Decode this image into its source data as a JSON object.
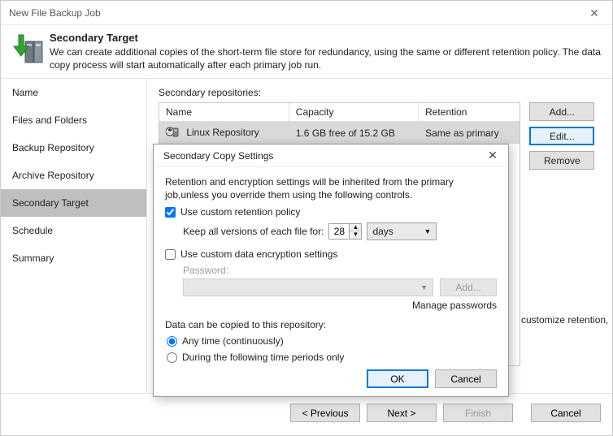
{
  "window": {
    "title": "New File Backup Job"
  },
  "header": {
    "title": "Secondary Target",
    "desc": "We can create additional copies of the short-term file store for redundancy, using the same or different retention policy. The data copy process will start automatically after each primary job run."
  },
  "sidebar": {
    "items": [
      {
        "label": "Name"
      },
      {
        "label": "Files and Folders"
      },
      {
        "label": "Backup Repository"
      },
      {
        "label": "Archive Repository"
      },
      {
        "label": "Secondary Target"
      },
      {
        "label": "Schedule"
      },
      {
        "label": "Summary"
      }
    ],
    "selected_index": 4
  },
  "main": {
    "list_label": "Secondary repositories:",
    "columns": {
      "c0": "Name",
      "c1": "Capacity",
      "c2": "Retention"
    },
    "rows": [
      {
        "name": "Linux Repository",
        "capacity": "1.6 GB free of 15.2 GB",
        "retention": "Same as primary"
      }
    ],
    "buttons": {
      "add": "Add...",
      "edit": "Edit...",
      "remove": "Remove"
    },
    "cust_note": "customize retention,"
  },
  "popup": {
    "title": "Secondary Copy Settings",
    "desc": "Retention and encryption settings will be inherited from the primary job,unless you override them using the following controls.",
    "use_custom_retention": "Use custom retention policy",
    "keep_label": "Keep all versions of each file for:",
    "keep_value": "28",
    "keep_unit": "days",
    "use_custom_encryption": "Use custom data encryption settings",
    "password_label": "Password:",
    "add_btn": "Add...",
    "manage": "Manage passwords",
    "copy_label": "Data can be copied to this repository:",
    "radio1": "Any time (continuously)",
    "radio2": "During the following time periods only",
    "ok": "OK",
    "cancel": "Cancel"
  },
  "footer": {
    "previous": "< Previous",
    "next": "Next >",
    "finish": "Finish",
    "cancel": "Cancel"
  }
}
